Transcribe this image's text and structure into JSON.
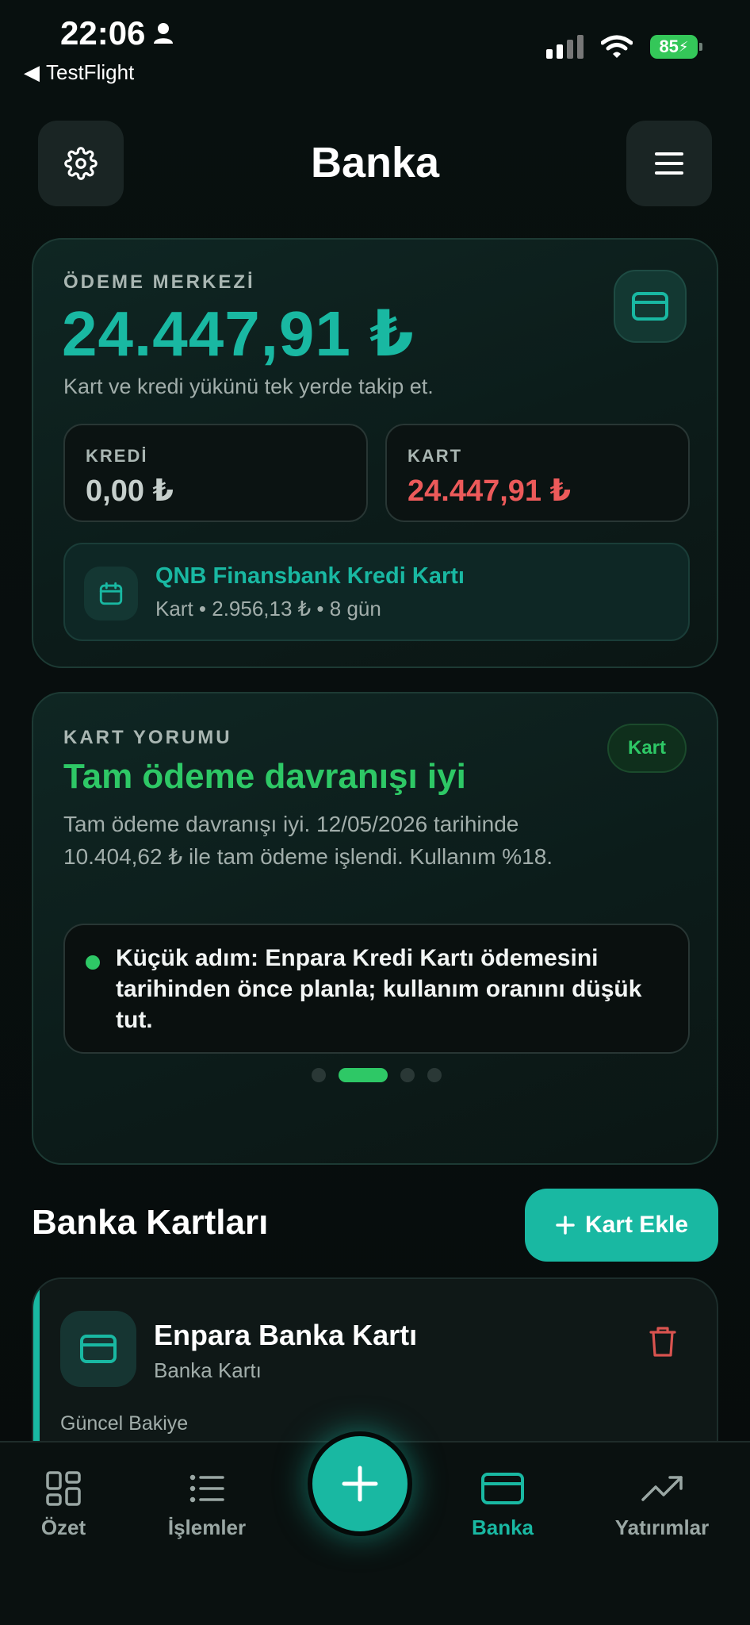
{
  "status_bar": {
    "time": "22:06",
    "back_app": "TestFlight",
    "battery": "85"
  },
  "header": {
    "title": "Banka"
  },
  "payment_center": {
    "label": "ÖDEME MERKEZİ",
    "total": "24.447,91 ₺",
    "subtitle": "Kart ve kredi yükünü tek yerde takip et.",
    "credit_label": "KREDİ",
    "credit_value": "0,00 ₺",
    "card_label": "KART",
    "card_value": "24.447,91 ₺",
    "upcoming": {
      "title": "QNB Finansbank Kredi Kartı",
      "detail": "Kart • 2.956,13 ₺ • 8 gün"
    }
  },
  "card_review": {
    "label": "KART YORUMU",
    "badge": "Kart",
    "headline": "Tam ödeme davranışı iyi",
    "description": "Tam ödeme davranışı iyi. 12/05/2026 tarihinde 10.404,62 ₺ ile tam ödeme işlendi. Kullanım %18.",
    "tip": "Küçük adım: Enpara Kredi Kartı ödemesini tarihinden önce planla; kullanım oranını düşük tut.",
    "page_count": 4,
    "active_page": 2
  },
  "bank_cards": {
    "title": "Banka Kartları",
    "add_button": "Kart Ekle",
    "items": [
      {
        "name": "Enpara Banka Kartı",
        "type": "Banka Kartı",
        "balance_label": "Güncel Bakiye"
      }
    ]
  },
  "bottom_nav": {
    "items": [
      {
        "label": "Özet",
        "icon": "grid-icon"
      },
      {
        "label": "İşlemler",
        "icon": "list-icon"
      },
      {
        "label": "Banka",
        "icon": "card-icon",
        "active": true
      },
      {
        "label": "Yatırımlar",
        "icon": "trending-up-icon"
      }
    ],
    "fab_icon": "plus-icon"
  },
  "colors": {
    "accent": "#19b8a2",
    "positive": "#2ec866",
    "negative": "#ec5a5a",
    "background": "#070d0d"
  }
}
